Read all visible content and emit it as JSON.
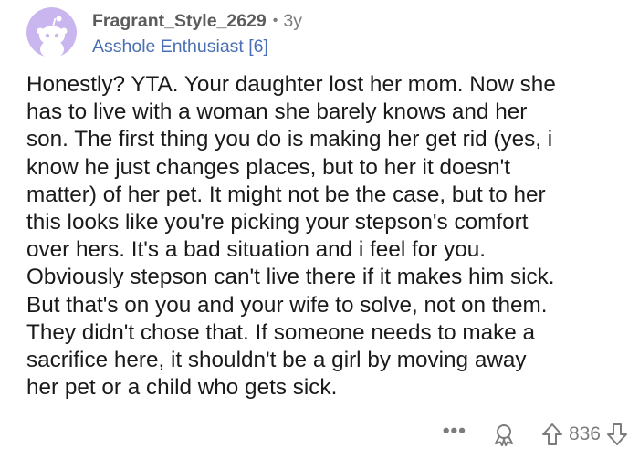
{
  "comment": {
    "username": "Fragrant_Style_2629",
    "separator": "•",
    "age": "3y",
    "flair": "Asshole Enthusiast [6]",
    "body": "Honestly? YTA. Your daughter lost her mom. Now she\nhas to live with a woman she barely knows and her\nson. The first thing you do is making her get rid (yes, i\nknow he just changes places, but to her it doesn't\nmatter) of her pet. It might not be the case, but to her\nthis looks like you're picking your stepson's comfort\nover hers. It's a bad situation and i feel for you.\nObviously stepson can't live there if it makes him sick.\nBut that's on you and your wife to solve, not on them.\nThey didn't chose that. If someone needs to make a\nsacrifice here, it shouldn't be a girl by moving away\nher pet or a child who gets sick.",
    "avatar": {
      "icon": "snoo-avatar-icon",
      "bg_color": "#c9b6ee",
      "figure_color": "#ffffff"
    }
  },
  "actions": {
    "more_label": "•••",
    "award_icon": "award-icon",
    "upvote_icon": "upvote-arrow-icon",
    "score": "836",
    "downvote_icon": "downvote-arrow-icon"
  },
  "colors": {
    "text": "#1a1a1b",
    "username": "#5c5c5c",
    "muted": "#7c7c7c",
    "flair": "#4a6fb5"
  }
}
